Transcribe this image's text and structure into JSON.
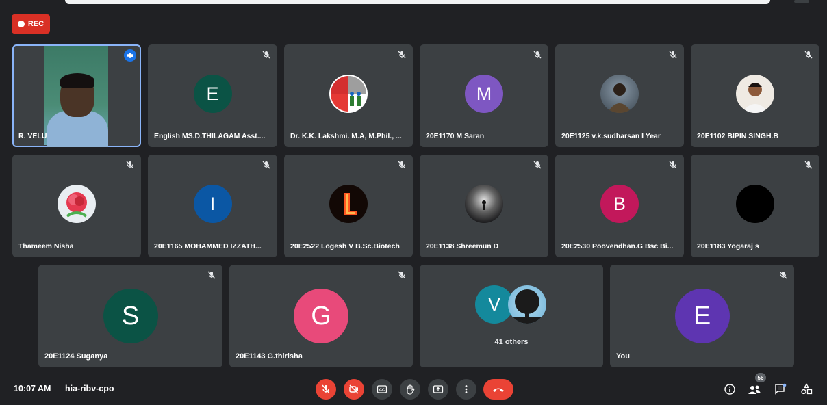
{
  "recording": {
    "label": "REC"
  },
  "participants": {
    "speaker": {
      "name": "R. VELU"
    },
    "row1": [
      {
        "name": "English MS.D.THILAGAM Asst....",
        "initial": "E",
        "color": "#0b5345"
      },
      {
        "name": "Dr. K.K. Lakshmi. M.A, M.Phil., ...",
        "initial": "",
        "color": "#ffffff"
      },
      {
        "name": "20E1170 M Saran",
        "initial": "M",
        "color": "#7e57c2"
      },
      {
        "name": "20E1125 v.k.sudharsan I Year",
        "initial": "",
        "color": "#5b6b7a"
      },
      {
        "name": "20E1102 BIPIN SINGH.B",
        "initial": "",
        "color": "#e9e4dc"
      }
    ],
    "row2": [
      {
        "name": "Thameem Nisha",
        "initial": "",
        "color": "#e9eef2"
      },
      {
        "name": "20E1165 MOHAMMED IZZATH...",
        "initial": "I",
        "color": "#0b57a4"
      },
      {
        "name": "20E2522 Logesh V B.Sc.Biotech",
        "initial": "",
        "color": "#120805"
      },
      {
        "name": "20E1138 Shreemun D",
        "initial": "",
        "color": "#1d1d1f"
      },
      {
        "name": "20E2530 Poovendhan.G Bsc Bi...",
        "initial": "B",
        "color": "#c2185b"
      },
      {
        "name": "20E1183 Yogaraj s",
        "initial": "",
        "color": "#000000"
      }
    ],
    "row3": [
      {
        "name": "20E1124 Suganya",
        "initial": "S",
        "color": "#0b5345"
      },
      {
        "name": "20E1143 G.thirisha",
        "initial": "G",
        "color": "#e84a7a"
      }
    ],
    "others": {
      "initial": "V",
      "color": "#14899c",
      "label": "41 others"
    },
    "self": {
      "name": "You",
      "initial": "E",
      "color": "#5e35b1"
    }
  },
  "bottom_bar": {
    "time": "10:07 AM",
    "meeting_code": "hia-ribv-cpo",
    "participant_count": "56"
  }
}
